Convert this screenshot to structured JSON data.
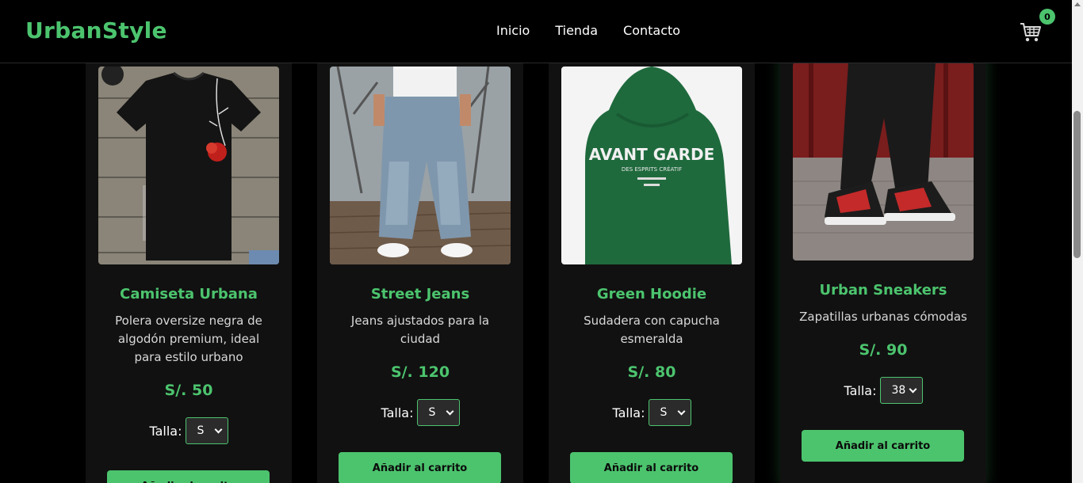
{
  "brand": "UrbanStyle",
  "nav": {
    "items": [
      "Inicio",
      "Tienda",
      "Contacto"
    ]
  },
  "cart": {
    "count": "0",
    "icon": "cart-icon"
  },
  "colors": {
    "accent": "#4cc46e",
    "background": "#000000",
    "card": "#111111"
  },
  "size_label": "Talla:",
  "products": [
    {
      "name": "Camiseta Urbana",
      "description": "Polera oversize negra de algodón premium, ideal para estilo urbano",
      "price": "S/. 50",
      "size": "S",
      "button": "Añadir al carrito",
      "image": "black-tshirt-rose-image"
    },
    {
      "name": "Street Jeans",
      "description": "Jeans ajustados para la ciudad",
      "price": "S/. 120",
      "size": "S",
      "button": "Añadir al carrito",
      "image": "baggy-jeans-image"
    },
    {
      "name": "Green Hoodie",
      "description": "Sudadera con capucha esmeralda",
      "price": "S/. 80",
      "size": "S",
      "button": "Añadir al carrito",
      "image": "green-hoodie-image"
    },
    {
      "name": "Urban Sneakers",
      "description": "Zapatillas urbanas cómodas",
      "price": "S/. 90",
      "size": "38",
      "button": "Añadir al carrito",
      "image": "sneakers-image"
    }
  ],
  "hoodie_print": {
    "line1": "AVANT GARDE",
    "line2": "DES ESPRITS CRÉATIF"
  }
}
